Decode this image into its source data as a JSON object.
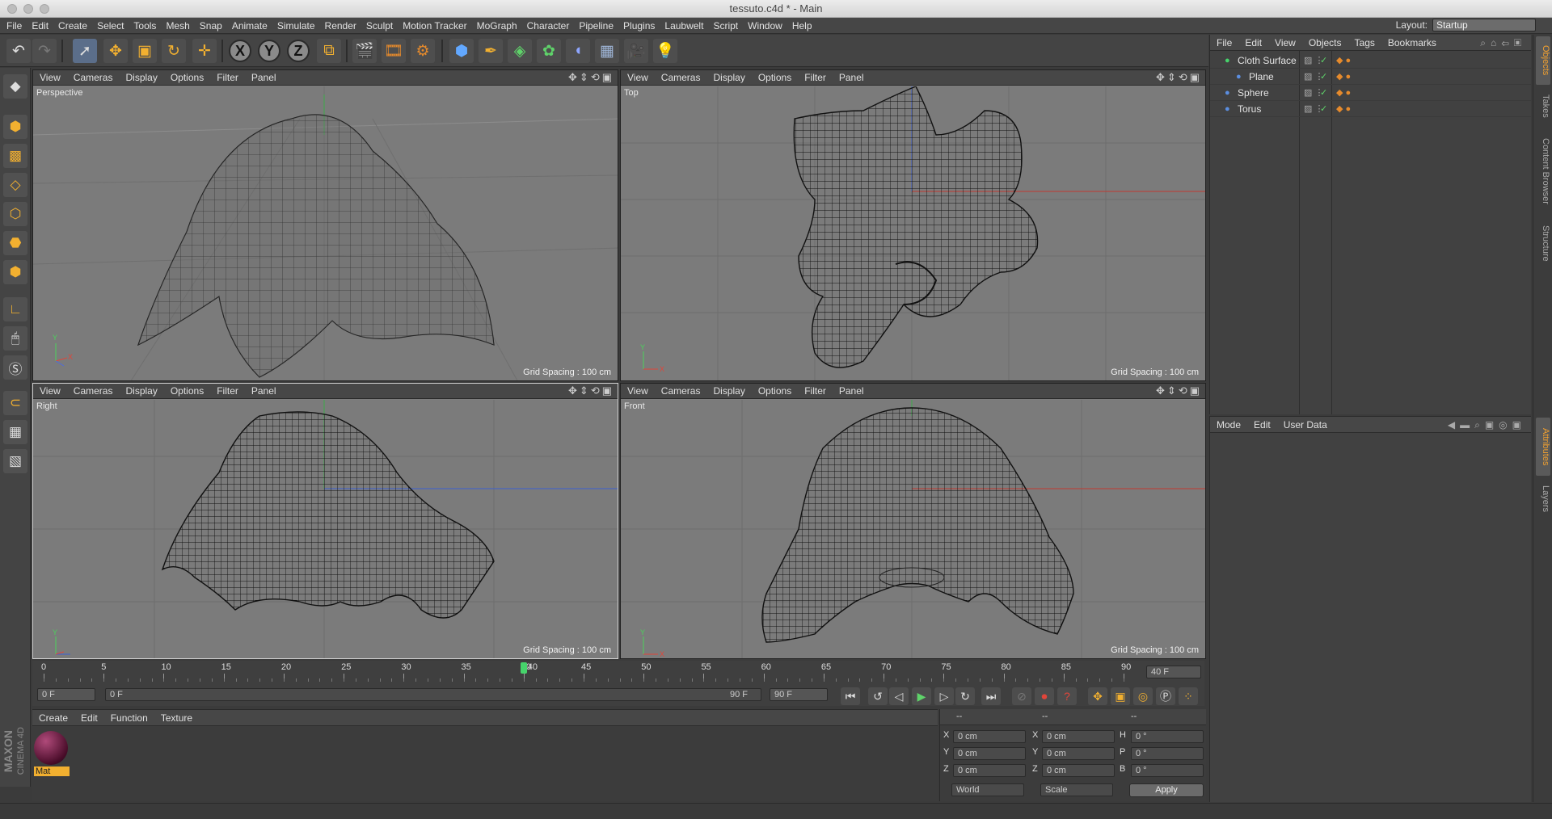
{
  "window": {
    "title": "tessuto.c4d * - Main"
  },
  "menu": [
    "File",
    "Edit",
    "Create",
    "Select",
    "Tools",
    "Mesh",
    "Snap",
    "Animate",
    "Simulate",
    "Render",
    "Sculpt",
    "Motion Tracker",
    "MoGraph",
    "Character",
    "Pipeline",
    "Plugins",
    "Laubwelt",
    "Script",
    "Window",
    "Help"
  ],
  "layout": {
    "label": "Layout:",
    "value": "Startup"
  },
  "viewport_menu": [
    "View",
    "Cameras",
    "Display",
    "Options",
    "Filter",
    "Panel"
  ],
  "viewports": {
    "perspective": {
      "name": "Perspective",
      "grid": "Grid Spacing : 100 cm"
    },
    "top": {
      "name": "Top",
      "grid": "Grid Spacing : 100 cm"
    },
    "right": {
      "name": "Right",
      "grid": "Grid Spacing : 100 cm"
    },
    "front": {
      "name": "Front",
      "grid": "Grid Spacing : 100 cm"
    }
  },
  "timeline": {
    "ticks": [
      "0",
      "5",
      "10",
      "15",
      "20",
      "25",
      "30",
      "35",
      "40",
      "45",
      "50",
      "55",
      "60",
      "65",
      "70",
      "75",
      "80",
      "85",
      "90"
    ],
    "current_frame": 40,
    "current_label": "40",
    "end_field": "40 F",
    "start_field": "0 F",
    "range_start": "0 F",
    "range_end": "90 F",
    "max_field": "90 F"
  },
  "material_panel": {
    "menu": [
      "Create",
      "Edit",
      "Function",
      "Texture"
    ],
    "material_name": "Mat"
  },
  "coords": {
    "headers": [
      "--",
      "--",
      "--"
    ],
    "rows": [
      {
        "a": "X",
        "v1": "0 cm",
        "b": "X",
        "v2": "0 cm",
        "c": "H",
        "v3": "0 °"
      },
      {
        "a": "Y",
        "v1": "0 cm",
        "b": "Y",
        "v2": "0 cm",
        "c": "P",
        "v3": "0 °"
      },
      {
        "a": "Z",
        "v1": "0 cm",
        "b": "Z",
        "v2": "0 cm",
        "c": "B",
        "v3": "0 °"
      }
    ],
    "mode": "World",
    "scale": "Scale",
    "apply": "Apply"
  },
  "objects_panel": {
    "menu": [
      "File",
      "Edit",
      "View",
      "Objects",
      "Tags",
      "Bookmarks"
    ],
    "items": [
      {
        "name": "Cloth Surface",
        "indent": 0,
        "color": "#46d36b"
      },
      {
        "name": "Plane",
        "indent": 1,
        "color": "#5b8ee0"
      },
      {
        "name": "Sphere",
        "indent": 0,
        "color": "#5b8ee0"
      },
      {
        "name": "Torus",
        "indent": 0,
        "color": "#5b8ee0"
      }
    ]
  },
  "attributes_panel": {
    "menu": [
      "Mode",
      "Edit",
      "User Data"
    ]
  },
  "right_tabs": {
    "top": [
      "Objects",
      "Takes",
      "Content Browser",
      "Structure"
    ],
    "bottom": [
      "Attributes",
      "Layers"
    ]
  },
  "brand": {
    "line1": "MAXON",
    "line2": "CINEMA 4D"
  }
}
